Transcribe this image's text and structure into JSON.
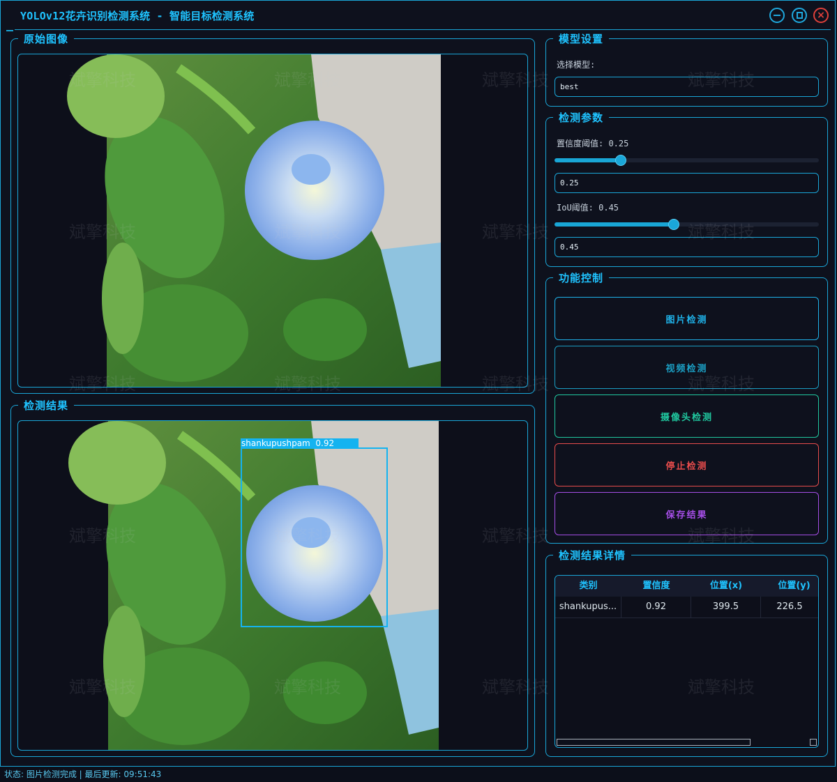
{
  "window": {
    "title": "YOLOv12花卉识别检测系统 - 智能目标检测系统"
  },
  "panels": {
    "original_title": "原始图像",
    "result_title": "检测结果",
    "model_settings_title": "模型设置",
    "detect_params_title": "检测参数",
    "function_control_title": "功能控制",
    "result_detail_title": "检测结果详情"
  },
  "detection": {
    "label": "shankupushpam",
    "score": "0.92",
    "label_text": "shankupushpam  0.92"
  },
  "model": {
    "select_label": "选择模型:",
    "selected": "best"
  },
  "params": {
    "conf_label": "置信度阈值: 0.25",
    "conf_value": "0.25",
    "conf_level": 0.25,
    "iou_label": "IoU阈值: 0.45",
    "iou_value": "0.45",
    "iou_level": 0.45
  },
  "controls": {
    "image_detect": "图片检测",
    "video_detect": "视频检测",
    "camera_detect": "摄像头检测",
    "stop_detect": "停止检测",
    "save_result": "保存结果"
  },
  "table": {
    "headers": [
      "类别",
      "置信度",
      "位置(x)",
      "位置(y)"
    ],
    "rows": [
      [
        "shankupus...",
        "0.92",
        "399.5",
        "226.5"
      ]
    ]
  },
  "status": {
    "text": "状态: 图片检测完成 | 最后更新: 09:51:43"
  },
  "watermark": "斌擎科技",
  "colors": {
    "accent": "#1fc3ff",
    "border": "#1aa7d9",
    "image_btn": "#1fb3ea",
    "video_btn": "#1b9fc4",
    "camera_btn": "#20c9a0",
    "stop_btn": "#e84c4c",
    "save_btn": "#a54ee6"
  }
}
